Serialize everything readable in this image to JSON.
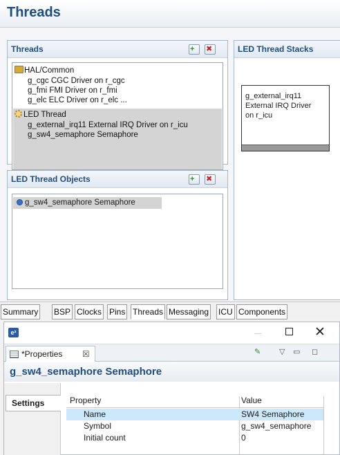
{
  "editor": {
    "title": "Threads",
    "threads_section": {
      "title": "Threads",
      "tree": [
        {
          "kind": "group",
          "icon": "folder-icon",
          "label": "HAL/Common"
        },
        {
          "kind": "child",
          "label": "g_cgc CGC Driver on r_cgc"
        },
        {
          "kind": "child",
          "label": "g_fmi FMI Driver on r_fmi"
        },
        {
          "kind": "child",
          "label": "g_elc ELC Driver on r_elc ..."
        },
        {
          "kind": "group",
          "icon": "gear-icon",
          "label": "LED Thread"
        },
        {
          "kind": "child",
          "label": "g_external_irq11 External IRQ Driver on r_icu"
        },
        {
          "kind": "child",
          "label": "g_sw4_semaphore Semaphore"
        }
      ]
    },
    "stacks_section": {
      "title": "LED Thread Stacks",
      "box_text": "g_external_irq11\nExternal IRQ Driver\non r_icu"
    },
    "objects_section": {
      "title": "LED Thread Objects",
      "items": [
        {
          "icon": "blue-dot-icon",
          "label": "g_sw4_semaphore Semaphore"
        }
      ]
    }
  },
  "tabs": [
    "Summary",
    "BSP",
    "Clocks",
    "Pins",
    "Threads",
    "Messaging",
    "ICU",
    "Components"
  ],
  "active_tab": "Threads",
  "properties_window": {
    "app_icon": "e²",
    "tab_label": "*Properties",
    "tab_close": "☒",
    "selection_title": "g_sw4_semaphore Semaphore",
    "settings_tab": "Settings",
    "table": {
      "headers": [
        "Property",
        "Value"
      ],
      "rows": [
        {
          "property": "Name",
          "value": "SW4 Semaphore",
          "selected": true
        },
        {
          "property": "Symbol",
          "value": "g_sw4_semaphore",
          "selected": false
        },
        {
          "property": "Initial count",
          "value": "0",
          "selected": false
        }
      ]
    }
  },
  "colors": {
    "title_blue": "#1e4d80",
    "selection_gray": "#d4d4d4",
    "row_highlight": "#cce8fb"
  }
}
